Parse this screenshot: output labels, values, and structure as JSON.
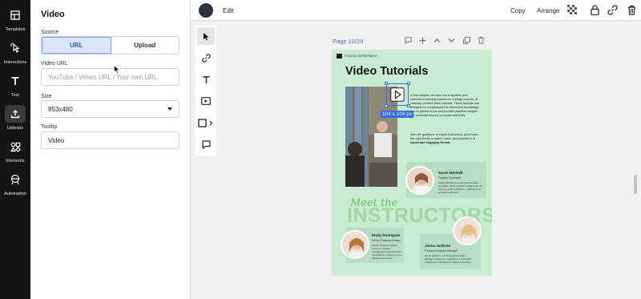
{
  "rail": {
    "items": [
      {
        "label": "Templates",
        "icon": "templates-icon"
      },
      {
        "label": "Interactions",
        "icon": "interactions-icon"
      },
      {
        "label": "Text",
        "icon": "text-icon"
      },
      {
        "label": "Uploads",
        "icon": "upload-icon"
      },
      {
        "label": "Elements",
        "icon": "elements-icon"
      },
      {
        "label": "Automation",
        "icon": "automation-icon"
      }
    ],
    "active": "Uploads"
  },
  "panel": {
    "title": "Video",
    "source_label": "Source",
    "source_options": [
      "URL",
      "Upload"
    ],
    "source_selected": "URL",
    "video_url_label": "Video URL",
    "video_url_placeholder": "YouTube / Vimeo URL / Your own URL",
    "video_url_value": "",
    "size_label": "Size",
    "size_value": "853x480",
    "tooltip_label": "Tooltip",
    "tooltip_value": "Video"
  },
  "topbar": {
    "edit": "Edit",
    "copy": "Copy",
    "arrange": "Arrange",
    "icons": [
      "transparency-icon",
      "lock-icon",
      "link-icon",
      "trash-icon"
    ]
  },
  "tools": [
    "select-icon",
    "link-icon",
    "text-icon",
    "video-icon",
    "shape-icon",
    "comment-icon"
  ],
  "canvas": {
    "page_label": "Page 10/20",
    "page_actions": [
      "comment-icon",
      "add-icon",
      "chevron-up-icon",
      "chevron-down-icon",
      "duplicate-icon",
      "trash-icon"
    ],
    "selection_dim": "104 x 104 px",
    "doc": {
      "brand": "FINANCE DEPARTMENT",
      "title": "Video Tutorials",
      "para1": "In this chapter, we dive into a dynamic and interactive learning experience through a series of carefully curated video tutorials. These tutorials are designed to complement the theoretical knowledge you've gained so far and provide practical insights into essential finance concepts and tools.",
      "para2_a": "With the guidance of expert instructors, you'll have the opportunity to watch, learn, and practice in a ",
      "para2_b": "visual and engaging format.",
      "meet": "Meet the",
      "instructors": "INSTRUCTORS",
      "people": [
        {
          "name": "Sarah Mitchell",
          "role": "Taxation Specialist",
          "desc": "Sarah Mitchell is a seasoned taxation specialist, offers practical insights into tax planning and compliance, making her an excellent instructor."
        },
        {
          "name": "Emily Rodrigues",
          "role": "Senior Treasury Analyst",
          "desc": "Senior Treasury Analyst known in treasury management and cash flow optimization, enhancing her effectiveness as an instructor."
        },
        {
          "name": "Jenna Jackson",
          "role": "Financial Analysis Manager",
          "desc": "Jenna Jackson, our Financial Analysis Manager, brings her experience to the team, making her invaluable for effective teaching."
        }
      ]
    }
  }
}
